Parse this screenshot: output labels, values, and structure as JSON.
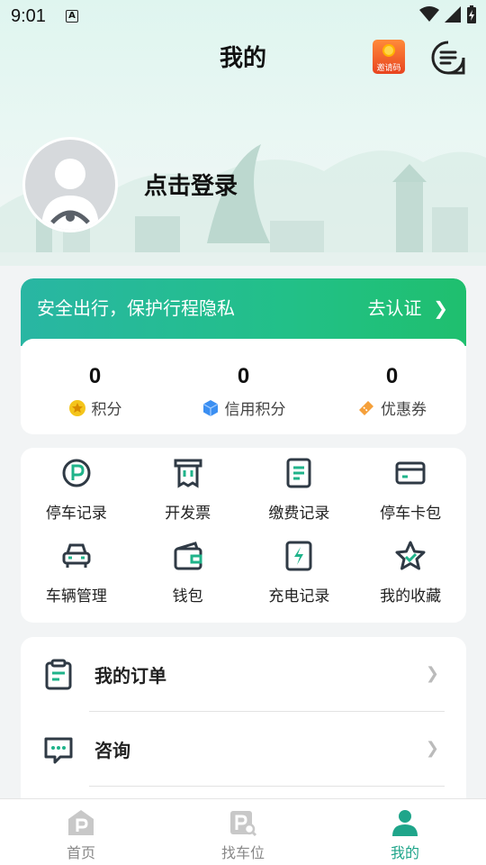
{
  "status_bar": {
    "time": "9:01",
    "notification_letter": "A"
  },
  "header": {
    "title": "我的",
    "invite_label": "邀请码"
  },
  "profile": {
    "login_text": "点击登录"
  },
  "verify": {
    "banner_text": "安全出行，保护行程隐私",
    "action_label": "去认证",
    "stats": [
      {
        "value": "0",
        "label": "积分",
        "icon": "coin-icon",
        "color": "#f4b400"
      },
      {
        "value": "0",
        "label": "信用积分",
        "icon": "cube-icon",
        "color": "#3b8ff2"
      },
      {
        "value": "0",
        "label": "优惠券",
        "icon": "coupon-icon",
        "color": "#f5a03a"
      }
    ]
  },
  "services": [
    {
      "label": "停车记录",
      "icon": "parking-icon"
    },
    {
      "label": "开发票",
      "icon": "invoice-icon"
    },
    {
      "label": "缴费记录",
      "icon": "payment-record-icon"
    },
    {
      "label": "停车卡包",
      "icon": "card-icon"
    },
    {
      "label": "车辆管理",
      "icon": "car-icon"
    },
    {
      "label": "钱包",
      "icon": "wallet-icon"
    },
    {
      "label": "充电记录",
      "icon": "charging-icon"
    },
    {
      "label": "我的收藏",
      "icon": "star-icon"
    }
  ],
  "menu": [
    {
      "label": "我的订单",
      "icon": "order-icon"
    },
    {
      "label": "咨询",
      "icon": "chat-icon"
    }
  ],
  "tabbar": {
    "tabs": [
      {
        "label": "首页",
        "icon": "home-parking-icon"
      },
      {
        "label": "找车位",
        "icon": "find-parking-icon"
      },
      {
        "label": "我的",
        "icon": "profile-icon",
        "active": true
      }
    ]
  },
  "colors": {
    "accent": "#1fa58a",
    "icon_dark": "#2f3a45"
  }
}
